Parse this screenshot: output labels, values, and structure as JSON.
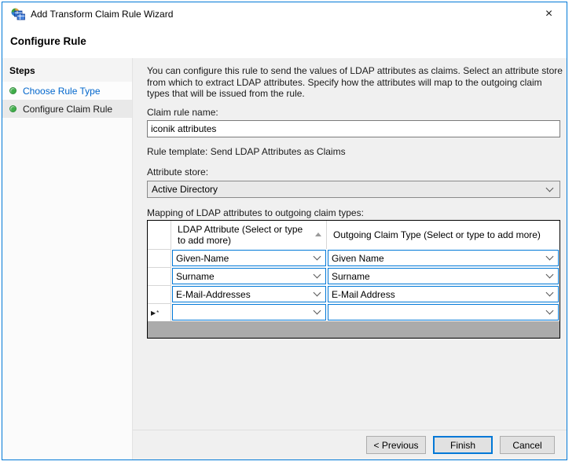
{
  "window": {
    "title": "Add Transform Claim Rule Wizard",
    "close_glyph": "×"
  },
  "page": {
    "heading": "Configure Rule"
  },
  "steps": {
    "header": "Steps",
    "items": [
      {
        "label": "Choose Rule Type",
        "state": "completed-link"
      },
      {
        "label": "Configure Claim Rule",
        "state": "current"
      }
    ]
  },
  "content": {
    "description": "You can configure this rule to send the values of LDAP attributes as claims. Select an attribute store from which to extract LDAP attributes. Specify how the attributes will map to the outgoing claim types that will be issued from the rule.",
    "claim_rule_name": {
      "label": "Claim rule name:",
      "value": "iconik attributes"
    },
    "rule_template": "Rule template: Send LDAP Attributes as Claims",
    "attribute_store": {
      "label": "Attribute store:",
      "value": "Active Directory"
    },
    "mapping_label": "Mapping of LDAP attributes to outgoing claim types:",
    "table": {
      "columns": [
        "LDAP Attribute (Select or type to add more)",
        "Outgoing Claim Type (Select or type to add more)"
      ],
      "new_row_marker": "▶*",
      "rows": [
        {
          "ldap": "Given-Name",
          "outgoing": "Given Name"
        },
        {
          "ldap": "Surname",
          "outgoing": "Surname"
        },
        {
          "ldap": "E-Mail-Addresses",
          "outgoing": "E-Mail Address"
        },
        {
          "ldap": "",
          "outgoing": ""
        }
      ]
    }
  },
  "footer": {
    "previous": "< Previous",
    "finish": "Finish",
    "cancel": "Cancel"
  },
  "colors": {
    "accent": "#0078d7",
    "link_blue": "#0066cc",
    "step_dot_green": "#3fae49",
    "content_bg": "#f0f0f0",
    "grid_filler": "#ababab",
    "button_bg": "#e1e1e1"
  }
}
